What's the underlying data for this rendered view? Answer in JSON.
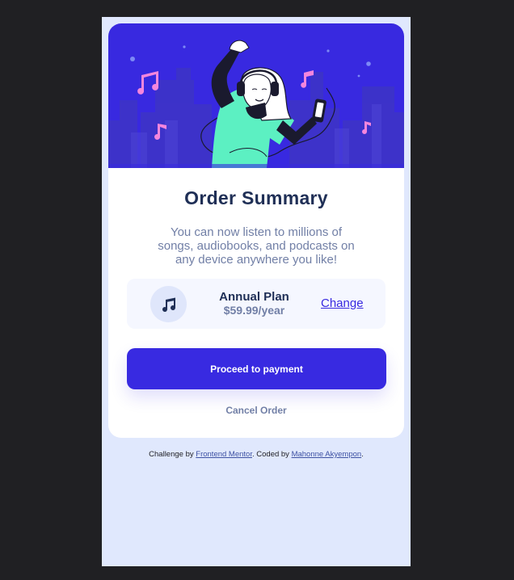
{
  "hero": {
    "image_alt": "illustration-hero"
  },
  "card": {
    "title": "Order Summary",
    "description": "You can now listen to millions of songs, audiobooks, and podcasts on any device anywhere you like!"
  },
  "plan": {
    "icon": "music-note-icon",
    "name": "Annual Plan",
    "price": "$59.99/year",
    "change_label": "Change"
  },
  "actions": {
    "proceed_label": "Proceed to payment",
    "cancel_label": "Cancel Order"
  },
  "attribution": {
    "prefix": "Challenge by ",
    "frontend_link": "Frontend Mentor",
    "middle": ". Coded by ",
    "author_link": "Mahonne Akyempon",
    "suffix": "."
  },
  "colors": {
    "page_bg": "#e0e8fd",
    "primary": "#382ae1",
    "dark_navy": "#1f2f56",
    "desaturated_blue": "#717fa6",
    "pale_blue": "#f5f7ff",
    "hero_bg": "#3829e0"
  }
}
